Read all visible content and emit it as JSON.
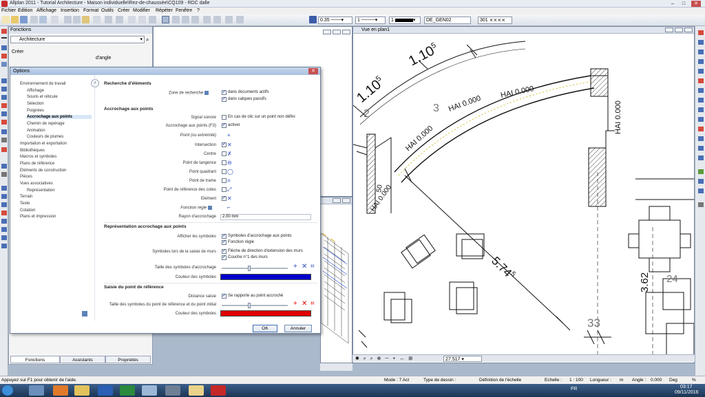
{
  "app": {
    "title": "Allplan 2011 - Tutorial Architecture - Maison individuelle\\Rez-de-chaussée\\CQ109 - RDC dalle"
  },
  "menu": [
    "Fichier",
    "Edition",
    "Affichage",
    "Insertion",
    "Format",
    "Outils",
    "Créer",
    "Modifier",
    "Répéter",
    "Fenêtre",
    "?"
  ],
  "toolbar": {
    "pen_thickness": "0.35",
    "line_type": "1",
    "color_index": "1",
    "layer": "DE_GEN02",
    "hatch": "301"
  },
  "functions_panel": {
    "title": "Fonctions",
    "module": "Architecture",
    "section": "Créer",
    "extra_label": "d'angle",
    "tabs": [
      "Fonctions",
      "Assistants",
      "Propriétés"
    ]
  },
  "viewports": {
    "plan_title": "Vue en plan1",
    "zoom_value": "27.517"
  },
  "drawing_labels": {
    "dim_top": "1.10",
    "dim_top_sup": "5",
    "dim_left": "1.10",
    "dim_left_sup": "5",
    "axis_2": "2",
    "axis_3": "3",
    "hai1": "HAI 0.000",
    "hai2": "HAI 0.000",
    "hai3": "HAI 0.000",
    "hai4": "HAI 0.000",
    "hai5": "HAI 0.000",
    "hai6": "HAI 0.000",
    "dim_diag": "5.74",
    "dim_diag_sup": "5",
    "dim_50": "50",
    "dim_right": "3.62",
    "dim_24": "24",
    "dim_33": "33"
  },
  "dialog": {
    "title": "Options",
    "tree": [
      {
        "label": "Environnement de travail",
        "level": 0
      },
      {
        "label": "Affichage",
        "level": 1
      },
      {
        "label": "Souris et réticule",
        "level": 1
      },
      {
        "label": "Sélection",
        "level": 1
      },
      {
        "label": "Poignées",
        "level": 1
      },
      {
        "label": "Accrochage aux points",
        "level": 1,
        "selected": true
      },
      {
        "label": "Chemin de repérage",
        "level": 1
      },
      {
        "label": "Animation",
        "level": 1
      },
      {
        "label": "Couleurs de plumes",
        "level": 1
      },
      {
        "label": "Importation et exportation",
        "level": 0
      },
      {
        "label": "Bibliothèques",
        "level": 0
      },
      {
        "label": "Macros et symboles",
        "level": 0
      },
      {
        "label": "Plans de référence",
        "level": 0
      },
      {
        "label": "Eléments de construction",
        "level": 0
      },
      {
        "label": "Pièces",
        "level": 0
      },
      {
        "label": "Vues associatives",
        "level": 0
      },
      {
        "label": "Représentation",
        "level": 1
      },
      {
        "label": "Terrain",
        "level": 0
      },
      {
        "label": "Texte",
        "level": 0
      },
      {
        "label": "Cotation",
        "level": 0
      },
      {
        "label": "Plans et impression",
        "level": 0
      }
    ],
    "sec_search": "Recherche d'éléments",
    "zone_label": "Zone de recherche",
    "zone_opt1": "dans documents actifs",
    "zone_opt2": "dans calques passifs",
    "sec_snap": "Accrochage aux points",
    "signal_label": "Signal sonore",
    "signal_opt": "En cas de clic sur un point non défini",
    "snap_f3_label": "Accrochage aux points (F3)",
    "snap_f3_opt": "activer",
    "point_label": "Point (ou extrémité)",
    "intersection_label": "Intersection",
    "centre_label": "Centre",
    "tangence_label": "Point de tangence",
    "quadrant_label": "Point quadrant",
    "trame_label": "Point de trame",
    "ref_cotes_label": "Point de référence des cotes",
    "element_label": "Elément",
    "fonction_regle_label": "Fonction règle",
    "rayon_label": "Rayon d'accrochage",
    "rayon_value": "2.00 mm",
    "sec_repr": "Représentation accrochage aux points",
    "afficher_label": "Afficher les symboles",
    "afficher_opt1": "Symboles d'accrochage aux points",
    "afficher_opt2": "Fonction règle",
    "saisie_murs_label": "Symboles lors de la saisie de murs",
    "saisie_opt1": "Flèche de direction d'extension des murs",
    "saisie_opt2": "Couche n°1 des murs",
    "taille_label": "Taille des symboles d'accrochage",
    "couleur_label": "Couleur des symboles",
    "sec_ref": "Saisie du point de référence",
    "distance_label": "Distance saisie",
    "distance_opt": "Se rapporte au point accroché",
    "taille_ref_label": "Taille des symboles du point de référence et du point initial",
    "couleur_ref_label": "Couleur des symboles",
    "ok": "OK",
    "cancel": "Annuler",
    "colors": {
      "snap_symbols": "#0000cc",
      "ref_symbols": "#e00000"
    }
  },
  "status": {
    "help": "Appuyez sur F1 pour obtenir de l'aide.",
    "mode": "Mode : 7 Act",
    "type_dessin": "Type de dessin :",
    "definition": "Définition de l'échelle",
    "echelle_label": "Echelle :",
    "echelle_value": "1 : 100",
    "longueur_label": "Longueur :",
    "longueur_unit": "m",
    "angle_label": "Angle :",
    "angle_value": "0.000",
    "deg_label": "Deg",
    "pct": "%"
  },
  "taskbar": {
    "lang": "FR",
    "time": "03:17",
    "date": "09/11/2016"
  }
}
